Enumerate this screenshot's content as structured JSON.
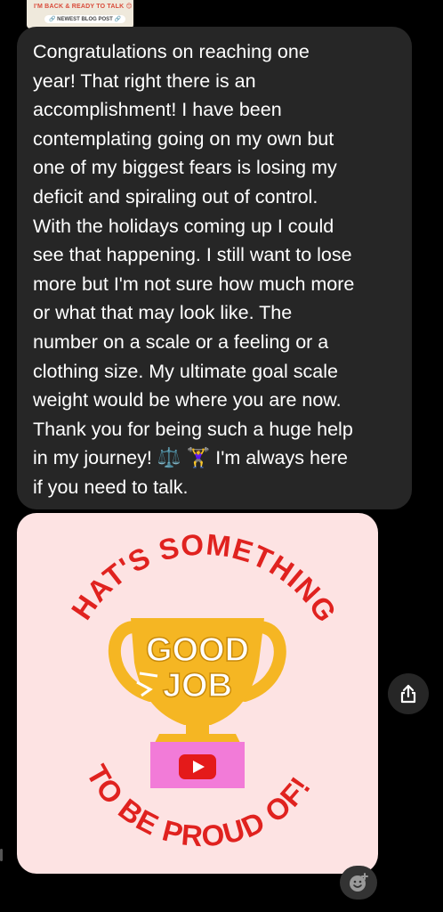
{
  "story_preview": {
    "line1": "I'M BACK & READY TO TALK 😊",
    "line2": "🔗 NEWEST BLOG POST 🔗"
  },
  "message": {
    "text": "Congratulations on reaching one\nyear! That right there is an\naccomplishment! I have been\ncontemplating going on my own but\none of my biggest fears is losing my\ndeficit and spiraling out of control.\nWith the holidays coming up I could\nsee that happening. I still want to lose\nmore but I'm not sure how much more\nor what that may look like.  The\nnumber on a scale or a feeling or a\nclothing size. My ultimate goal scale\nweight would be where you are now.\nThank you for being such a huge help\nin my journey! ⚖️ 🏋️‍♀️  I'm always here\nif you need to talk."
  },
  "sticker": {
    "top_arc": "THAT'S SOMETHING",
    "bottom_arc": "TO BE PROUD OF!",
    "cup_line1": "GOOD",
    "cup_line2": "JOB",
    "colors": {
      "background": "#fde3e3",
      "text_red": "#e0221f",
      "cup_yellow": "#f5b623",
      "cup_white_text": "#ffffff",
      "base_pink": "#f27bd8",
      "play_red": "#e41a1a"
    }
  },
  "icons": {
    "share": "share-icon",
    "reaction": "add-reaction-icon",
    "video": "play-icon"
  }
}
